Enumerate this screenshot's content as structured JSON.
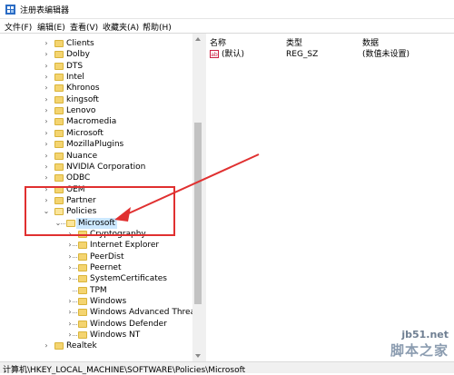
{
  "window": {
    "title": "注册表编辑器"
  },
  "menu": [
    "文件(F)",
    "编辑(E)",
    "查看(V)",
    "收藏夹(A)",
    "帮助(H)"
  ],
  "tree": [
    {
      "label": "Clients"
    },
    {
      "label": "Dolby"
    },
    {
      "label": "DTS"
    },
    {
      "label": "Intel"
    },
    {
      "label": "Khronos"
    },
    {
      "label": "kingsoft"
    },
    {
      "label": "Lenovo"
    },
    {
      "label": "Macromedia"
    },
    {
      "label": "Microsoft"
    },
    {
      "label": "MozillaPlugins"
    },
    {
      "label": "Nuance"
    },
    {
      "label": "NVIDIA Corporation"
    },
    {
      "label": "ODBC"
    },
    {
      "label": "OEM"
    },
    {
      "label": "Partner"
    },
    {
      "label": "Policies"
    },
    {
      "label": "Microsoft"
    },
    {
      "label": "Cryptography"
    },
    {
      "label": "Internet Explorer"
    },
    {
      "label": "PeerDist"
    },
    {
      "label": "Peernet"
    },
    {
      "label": "SystemCertificates"
    },
    {
      "label": "TPM"
    },
    {
      "label": "Windows"
    },
    {
      "label": "Windows Advanced Threat P"
    },
    {
      "label": "Windows Defender"
    },
    {
      "label": "Windows NT"
    },
    {
      "label": "Realtek"
    }
  ],
  "list": {
    "columns": {
      "name": "名称",
      "type": "类型",
      "data": "数据"
    },
    "rows": [
      {
        "icon": "ab",
        "name": "(默认)",
        "type": "REG_SZ",
        "data": "(数值未设置)"
      }
    ]
  },
  "status": {
    "path": "计算机\\HKEY_LOCAL_MACHINE\\SOFTWARE\\Policies\\Microsoft"
  },
  "watermark": {
    "url": "jb51.net",
    "name": "脚本之家"
  },
  "colors": {
    "annotation": "#e03030",
    "selection": "#cce8ff",
    "folder": "#f4d470"
  }
}
